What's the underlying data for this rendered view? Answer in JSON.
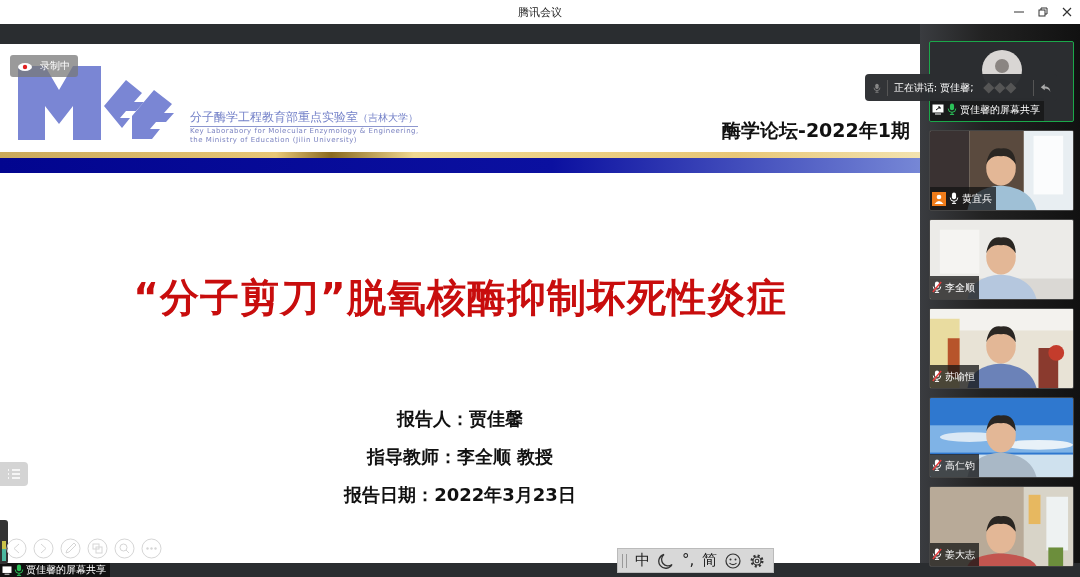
{
  "window": {
    "title": "腾讯会议"
  },
  "recording": {
    "label": "录制中"
  },
  "slide": {
    "lab_cn": "分子酶学工程教育部重点实验室",
    "lab_note": "（吉林大学）",
    "lab_en": [
      "Key Laborabory for Molecular Enzymology & Engineering,",
      "the Ministry of Education (Jilin University)"
    ],
    "series": "酶学论坛-2022年1期",
    "title": "“分子剪刀”脱氧核酶抑制坏死性炎症",
    "details": [
      "报告人：贾佳馨",
      "指导教师：李全顺 教授",
      "报告日期：2022年3月23日"
    ]
  },
  "speaking": {
    "label": "正在讲话: 贾佳馨;"
  },
  "participants": [
    {
      "name": "贾佳馨的屏幕共享",
      "kind": "screen",
      "speaking": true,
      "muted": false,
      "host": false
    },
    {
      "name": "黄宜兵",
      "kind": "camera",
      "speaking": false,
      "muted": false,
      "host": true
    },
    {
      "name": "李全顺",
      "kind": "camera",
      "speaking": false,
      "muted": true,
      "host": false
    },
    {
      "name": "苏喻恒",
      "kind": "camera",
      "speaking": false,
      "muted": true,
      "host": false
    },
    {
      "name": "高仁钧",
      "kind": "camera",
      "speaking": false,
      "muted": true,
      "host": false
    },
    {
      "name": "姜大志",
      "kind": "camera",
      "speaking": false,
      "muted": true,
      "host": false
    }
  ],
  "share_label": "贾佳馨的屏幕共享",
  "ime": [
    {
      "kind": "text",
      "label": "中"
    },
    {
      "kind": "moon"
    },
    {
      "kind": "text",
      "label": "°,"
    },
    {
      "kind": "text",
      "label": "简"
    },
    {
      "kind": "smile"
    },
    {
      "kind": "gear"
    }
  ]
}
